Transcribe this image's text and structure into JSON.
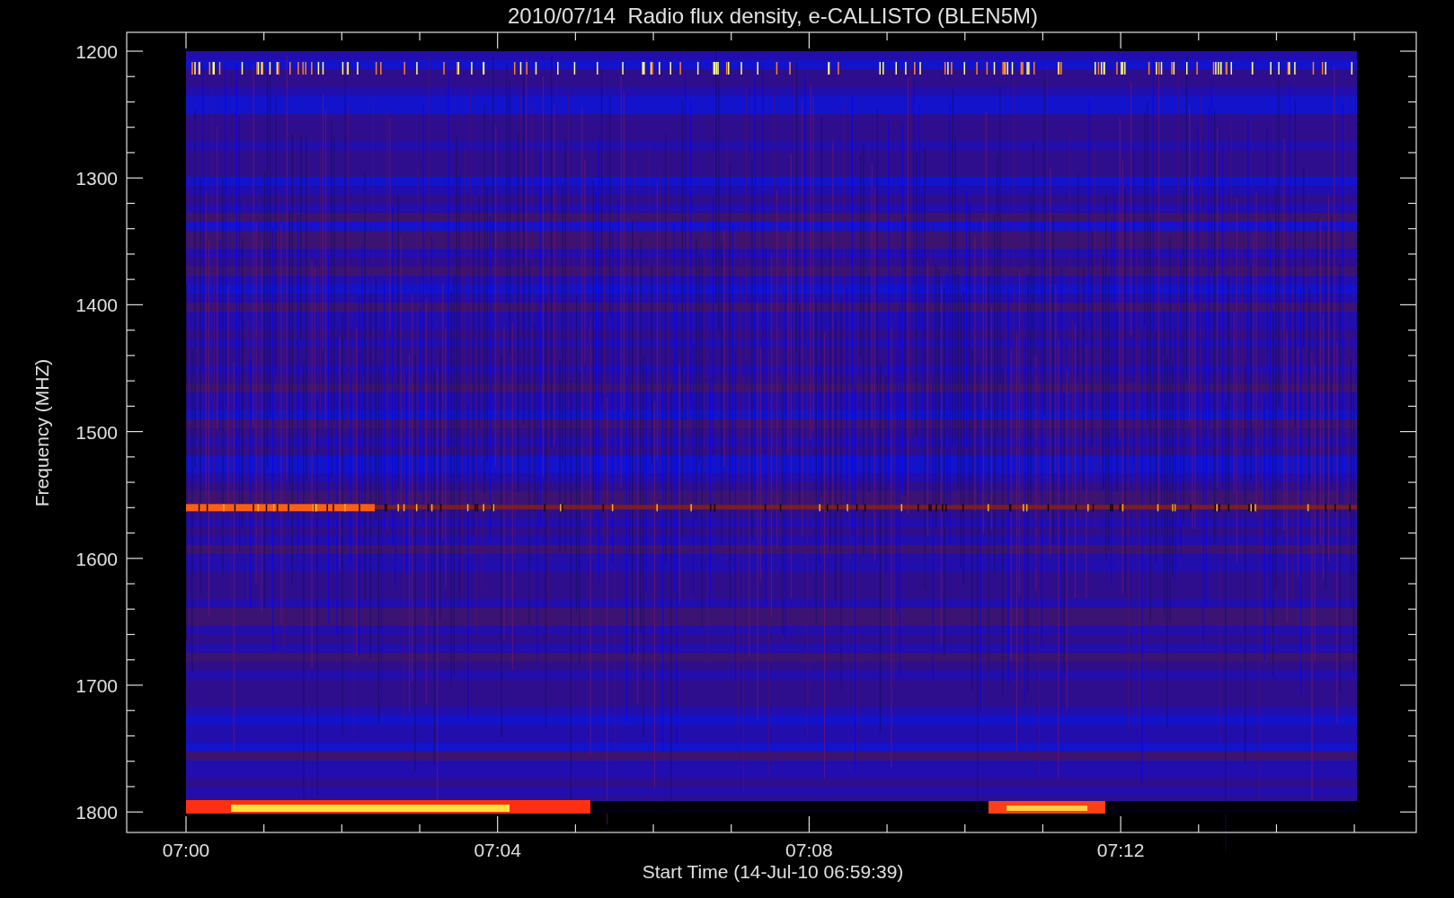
{
  "plot": {
    "title": "2010/07/14  Radio flux density, e-CALLISTO (BLEN5M)",
    "ylabel": "Frequency (MHZ)",
    "xlabel": "Start Time (14-Jul-10 06:59:39)",
    "yticks": [
      "1200",
      "1300",
      "1400",
      "1500",
      "1600",
      "1700",
      "1800"
    ],
    "xticks": [
      "07:00",
      "07:04",
      "07:08",
      "07:12"
    ]
  }
}
